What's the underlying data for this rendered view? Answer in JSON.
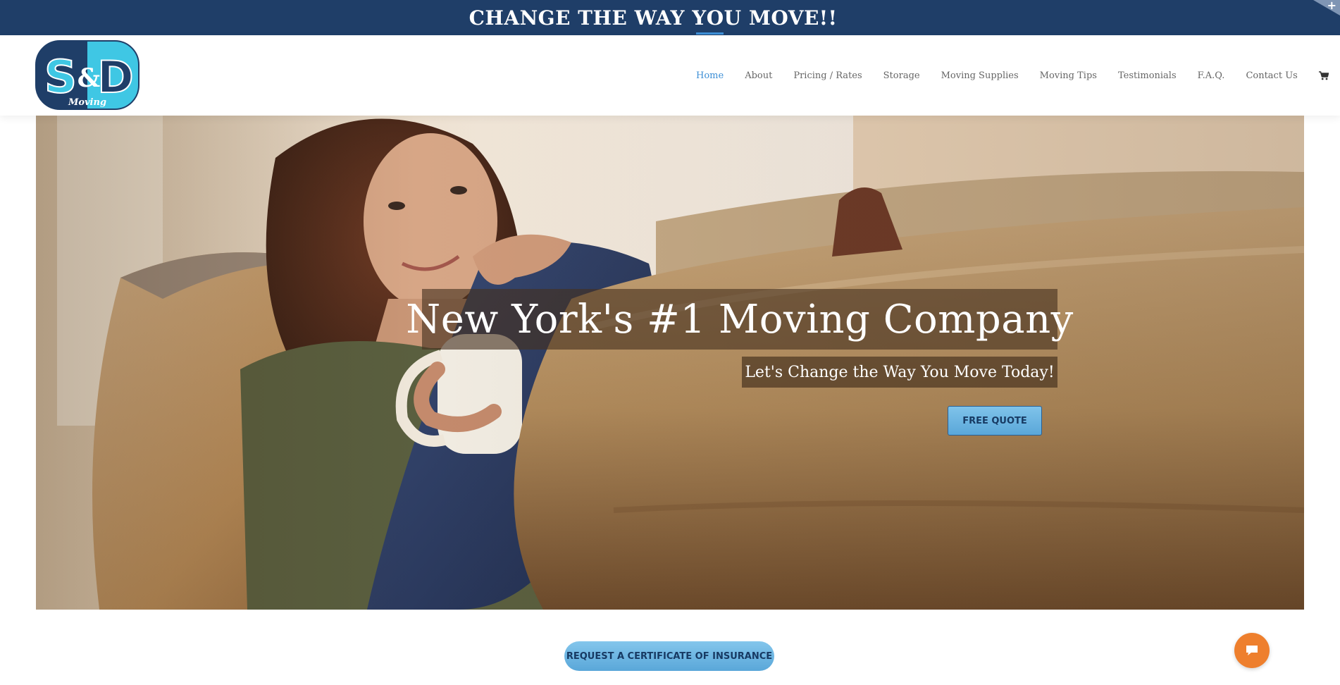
{
  "banner": {
    "text": "CHANGE THE WAY YOU MOVE!!",
    "corner_icon": "plus-icon",
    "corner_symbol": "+"
  },
  "logo": {
    "letters_left": "S",
    "ampersand": "&",
    "letters_right": "D",
    "script": "Moving"
  },
  "nav": {
    "items": [
      {
        "label": "Home",
        "active": true
      },
      {
        "label": "About"
      },
      {
        "label": "Pricing / Rates"
      },
      {
        "label": "Storage"
      },
      {
        "label": "Moving Supplies"
      },
      {
        "label": "Moving Tips"
      },
      {
        "label": "Testimonials"
      },
      {
        "label": "F.A.Q."
      },
      {
        "label": "Contact Us"
      }
    ],
    "cart_icon": "cart-icon",
    "search_icon": "search-icon"
  },
  "hero": {
    "title": "New York's #1 Moving Company",
    "subtitle": "Let's Change the Way You Move Today!",
    "button": "FREE QUOTE"
  },
  "certificate_button": "REQUEST A CERTIFICATE OF INSURANCE",
  "chat_icon": "chat-bubble-icon",
  "colors": {
    "banner_bg": "#1f3e68",
    "nav_active": "#3d8fd6",
    "button_blue": "#5aa7d9",
    "chat_orange": "#ee7f2d"
  }
}
